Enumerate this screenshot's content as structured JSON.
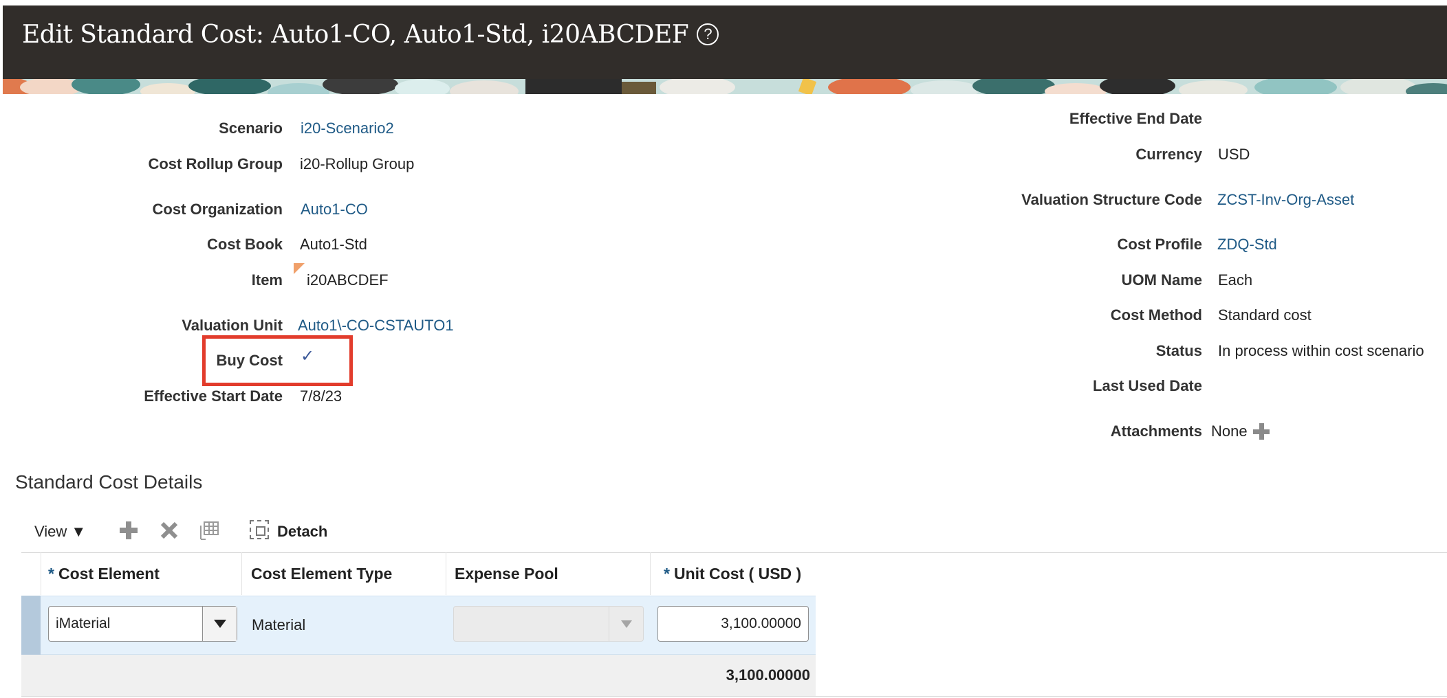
{
  "header": {
    "title": "Edit Standard Cost: Auto1-CO, Auto1-Std, i20ABCDEF",
    "help_icon": "?"
  },
  "left_fields": {
    "scenario": {
      "label": "Scenario",
      "value": "i20-Scenario2"
    },
    "cost_rollup_group": {
      "label": "Cost Rollup Group",
      "value": "i20-Rollup Group"
    },
    "cost_organization": {
      "label": "Cost Organization",
      "value": "Auto1-CO"
    },
    "cost_book": {
      "label": "Cost Book",
      "value": "Auto1-Std"
    },
    "item": {
      "label": "Item",
      "value": "i20ABCDEF"
    },
    "valuation_unit": {
      "label": "Valuation Unit",
      "value": "Auto1\\-CO-CSTAUTO1"
    },
    "buy_cost": {
      "label": "Buy Cost",
      "value": "✓",
      "checked": true
    },
    "effective_start_date": {
      "label": "Effective Start Date",
      "value": "7/8/23"
    }
  },
  "right_fields": {
    "effective_end_date": {
      "label": "Effective End Date",
      "value": ""
    },
    "currency": {
      "label": "Currency",
      "value": "USD"
    },
    "valuation_structure_code": {
      "label": "Valuation Structure Code",
      "value": "ZCST-Inv-Org-Asset"
    },
    "cost_profile": {
      "label": "Cost Profile",
      "value": "ZDQ-Std"
    },
    "uom_name": {
      "label": "UOM Name",
      "value": "Each"
    },
    "cost_method": {
      "label": "Cost Method",
      "value": "Standard cost"
    },
    "status": {
      "label": "Status",
      "value": "In process within cost scenario"
    },
    "last_used_date": {
      "label": "Last Used Date",
      "value": ""
    },
    "attachments": {
      "label": "Attachments",
      "value": "None"
    }
  },
  "section": {
    "title": "Standard Cost Details"
  },
  "toolbar": {
    "view_label": "View ▼",
    "add_icon": "plus-icon",
    "delete_icon": "delete-x-icon",
    "freeze_icon": "freeze-columns-icon",
    "detach_label": "Detach"
  },
  "table": {
    "required_marker": "*",
    "columns": [
      "Cost Element",
      "Cost Element Type",
      "Expense Pool",
      "Unit Cost ( USD )"
    ],
    "rows": [
      {
        "cost_element": "iMaterial",
        "cost_element_type": "Material",
        "expense_pool": "",
        "unit_cost": "3,100.00000"
      }
    ],
    "total": "3,100.00000"
  },
  "colors": {
    "header_bg": "#312d2a",
    "link": "#1f5a86",
    "highlight_box": "#e23c2c",
    "selected_row": "#e5f1fb"
  }
}
